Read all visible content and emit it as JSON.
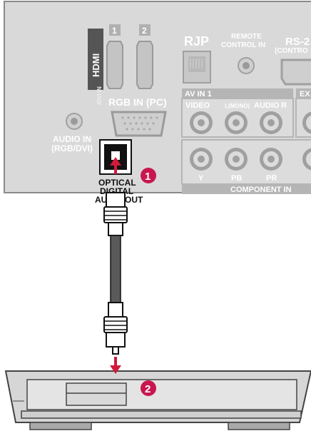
{
  "tv_panel": {
    "hdmi_logo": "HDMI",
    "hdmi_suffix": "/DVI IN",
    "hdmi_port_1": "1",
    "hdmi_port_2": "2",
    "rgb_in_label": "RGB IN (PC)",
    "rjp_label": "RJP",
    "remote_label_line1": "REMOTE",
    "remote_label_line2": "CONTROL IN",
    "rs232_line1": "RS-2",
    "rs232_line2": "(CONTRO",
    "av_in_label": "AV IN 1",
    "ext_label": "EX",
    "video_label": "VIDEO",
    "l_mono_label": "L(MONO)",
    "audio_label": "AUDIO",
    "r_label": "R",
    "audio_in_line1": "AUDIO IN",
    "audio_in_line2": "(RGB/DVI)",
    "y_label": "Y",
    "pb_label": "PB",
    "pr_label": "PR",
    "component_label": "COMPONENT IN",
    "optical_line1": "OPTICAL",
    "optical_line2": "DIGITAL",
    "optical_line3": "AUDIO OUT"
  },
  "steps": [
    {
      "number": "1"
    },
    {
      "number": "2"
    }
  ],
  "colors": {
    "panel": "#d8d8d8",
    "panel_border": "#888888",
    "accent_badge": "#c8174f",
    "arrow": "#d11a3c",
    "cable": "#5a5a5a"
  }
}
